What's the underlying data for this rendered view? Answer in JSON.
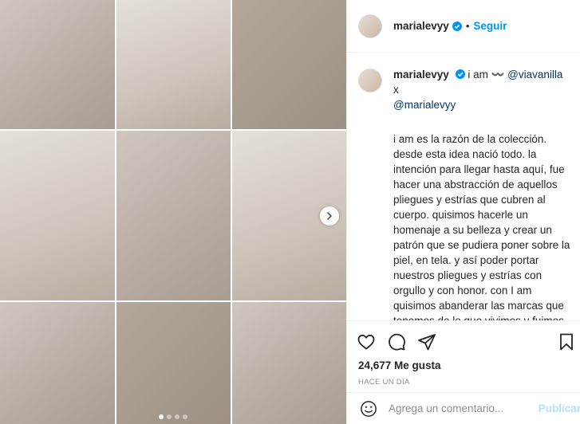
{
  "post": {
    "username": "marialevyy",
    "follow_label": "Seguir",
    "separator": "•",
    "verified_icon": "verified-badge-icon",
    "accent_color": "#0095f6"
  },
  "caption": {
    "username": "marialevyy",
    "prefix": "i am 〰️ ",
    "mention_1": "@viavanilla",
    "joiner": " x",
    "mention_2": "@marialevyy",
    "body": "i am es la razón de la colección. desde esta idea nació todo. la intención para llegar hasta aquí, fue hacer una abstracción de aquellos pliegues y estrías que cubren al cuerpo. quisimos hacerle un homenaje a su belleza y crear un patrón que se pudiera poner sobre la piel, en tela. y así poder portar nuestros pliegues y estrías con orgullo y con honor. con I am quisimos abanderar las marcas que tenemos de lo que vivimos y fuimos. lo que llevamos en la piel como testigo de lo que nos hizo, lo que somos y un recordatorio de lo fuerte que siempre seremos. todo lo recorrido y a su paso las marcas que"
  },
  "actions": {
    "icons": [
      "heart-icon",
      "comment-icon",
      "share-icon",
      "bookmark-icon"
    ],
    "likes": "24,677 Me gusta",
    "time": "HACE UN DÍA"
  },
  "comment_box": {
    "placeholder": "Agrega un comentario...",
    "publish_label": "Publicar",
    "emoji_icon": "emoji-icon"
  },
  "media": {
    "carousel_dots": 4,
    "active_dot": 1
  }
}
